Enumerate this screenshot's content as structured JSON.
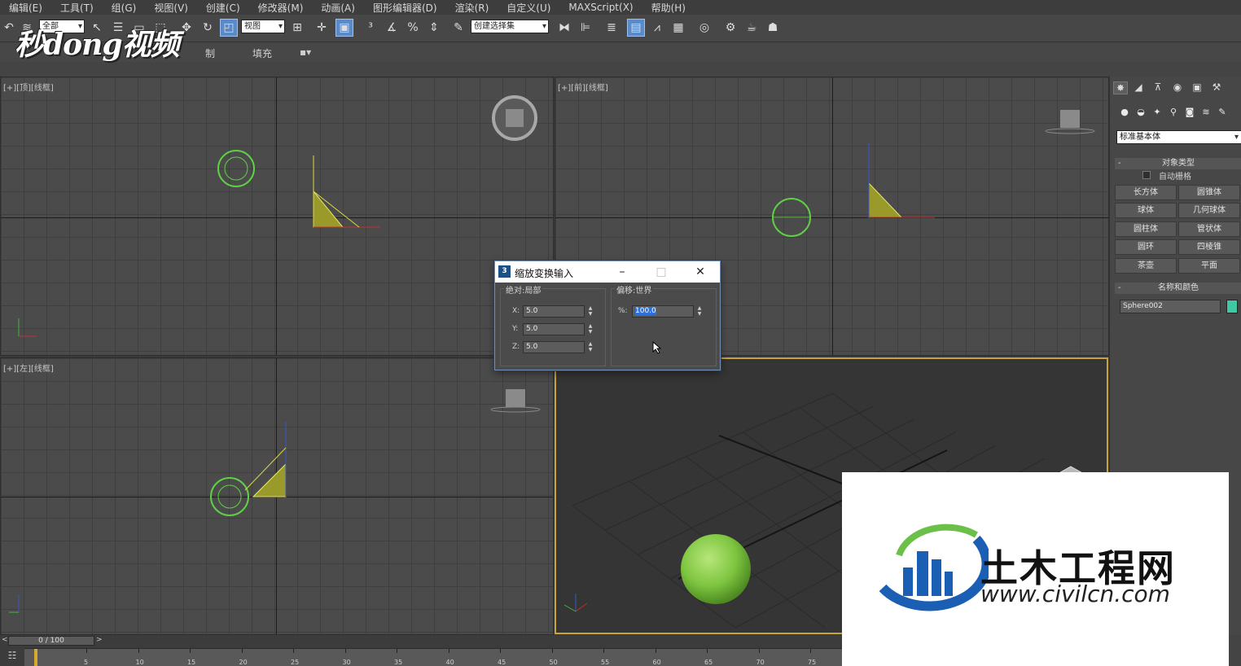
{
  "menu": [
    "编辑(E)",
    "工具(T)",
    "组(G)",
    "视图(V)",
    "创建(C)",
    "修改器(M)",
    "动画(A)",
    "图形编辑器(D)",
    "渲染(R)",
    "自定义(U)",
    "MAXScript(X)",
    "帮助(H)"
  ],
  "toolbar": {
    "filter_value": "全部",
    "coord_value": "视图",
    "selection_set_placeholder": "创建选择集"
  },
  "ribbon": {
    "item1": "制",
    "item2": "填充"
  },
  "viewports": {
    "top_label": "[+][顶][线框]",
    "front_label": "[+][前][线框]",
    "left_label": "[+][左][线框]"
  },
  "command_panel": {
    "dropdown_value": "标准基本体",
    "object_type_title": "对象类型",
    "autogrid_label": "自动栅格",
    "object_buttons": [
      "长方体",
      "圆锥体",
      "球体",
      "几何球体",
      "圆柱体",
      "管状体",
      "圆环",
      "四棱锥",
      "茶壶",
      "平面"
    ],
    "name_color_title": "名称和颜色",
    "object_name": "Sphere002",
    "swatch_color": "#3fc9a3"
  },
  "dialog": {
    "title": "缩放变换输入",
    "left_group_title": "绝对:局部",
    "right_group_title": "偏移:世界",
    "x_label": "X:",
    "y_label": "Y:",
    "z_label": "Z:",
    "x_value": "5.0",
    "y_value": "5.0",
    "z_value": "5.0",
    "pct_label": "%:",
    "pct_value": "100.0"
  },
  "timeline": {
    "slider_text": "0 / 100",
    "ticks": [
      "5",
      "10",
      "15",
      "20",
      "25",
      "30",
      "35",
      "40",
      "45",
      "50",
      "55",
      "60",
      "65",
      "70",
      "75"
    ]
  },
  "watermark_top": "秒dong视频",
  "watermark_site_name": "土木工程网",
  "watermark_site_url": "www.civilcn.com"
}
